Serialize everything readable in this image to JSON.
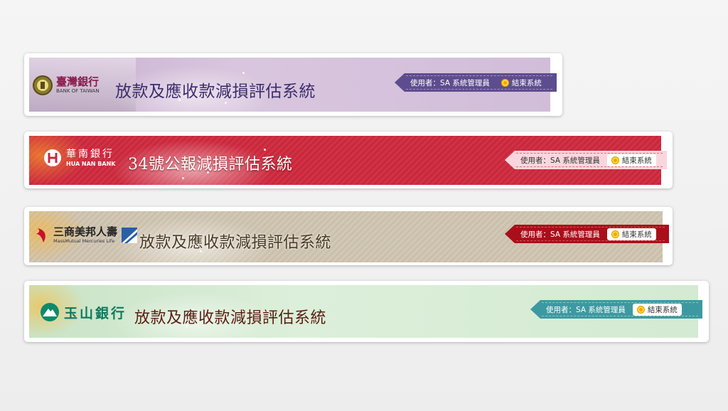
{
  "colors": {
    "purple_ribbon": "#5e4d8e",
    "red_band": "#c8283c",
    "dark_red_ribbon": "#a90f1a",
    "teal_ribbon": "#3d99a1"
  },
  "banners": [
    {
      "logo_cn": "臺灣銀行",
      "logo_en": "BANK OF TAIWAN",
      "title": "放款及應收款減損評估系統",
      "user_label": "使用者：SA 系統管理員",
      "logout_label": "結束系統"
    },
    {
      "logo_cn": "華南銀行",
      "logo_en": "HUA NAN BANK",
      "title": "34號公報減損評估系統",
      "user_label": "使用者：SA 系統管理員",
      "logout_label": "結束系統"
    },
    {
      "logo_cn": "三商美邦人壽",
      "logo_en": "MassMutual Mercuries Life",
      "title": "放款及應收款減損評估系統",
      "user_label": "使用者：SA 系統管理員",
      "logout_label": "結束系統"
    },
    {
      "logo_cn": "玉山銀行",
      "logo_en": "",
      "title": "放款及應收款減損評估系統",
      "user_label": "使用者：SA 系統管理員",
      "logout_label": "結束系統"
    }
  ]
}
